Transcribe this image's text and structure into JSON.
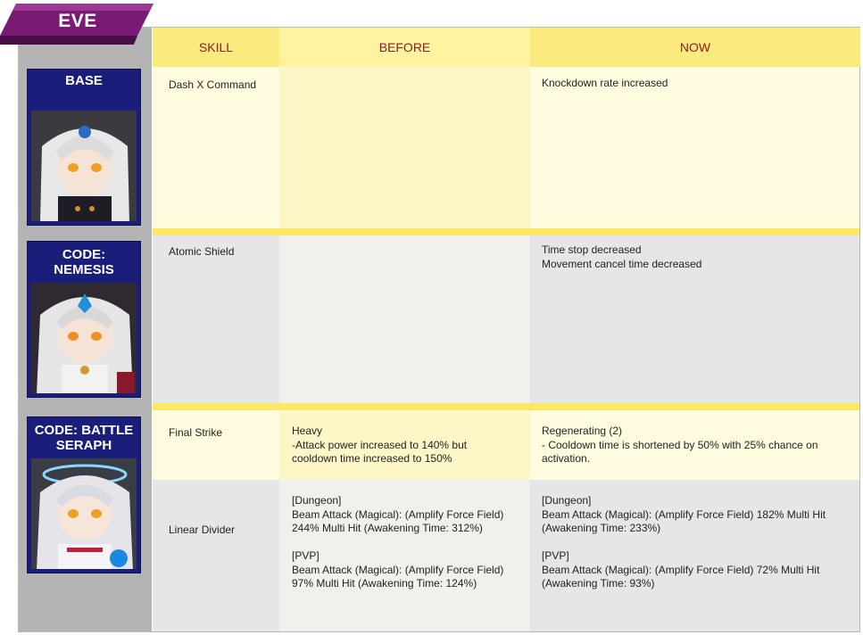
{
  "character": "EVE",
  "headers": {
    "skill": "SKILL",
    "before": "BEFORE",
    "now": "NOW"
  },
  "classes": [
    {
      "name": "BASE"
    },
    {
      "name": "CODE: NEMESIS"
    },
    {
      "name": "CODE: BATTLE SERAPH"
    }
  ],
  "rows": [
    {
      "skill": "Dash X Command",
      "before": [],
      "now": [
        "Knockdown rate increased"
      ]
    },
    {
      "skill": "Atomic Shield",
      "before": [],
      "now": [
        "Time stop decreased",
        "Movement cancel time decreased"
      ]
    },
    {
      "skill": "Final Strike",
      "before": [
        "Heavy",
        "-Attack power increased to 140% but",
        "cooldown time increased to 150%"
      ],
      "now": [
        "Regenerating (2)",
        "- Cooldown time is shortened by 50% with 25% chance on",
        "activation."
      ]
    },
    {
      "skill": "Linear Divider",
      "before": [
        "[Dungeon]",
        "Beam Attack (Magical): (Amplify Force Field)",
        "244% Multi Hit (Awakening Time: 312%)",
        "",
        "[PVP]",
        "Beam Attack (Magical): (Amplify Force Field)",
        "97% Multi Hit (Awakening Time: 124%)"
      ],
      "now": [
        "[Dungeon]",
        "Beam Attack (Magical): (Amplify Force Field) 182% Multi Hit",
        "(Awakening Time: 233%)",
        "",
        "[PVP]",
        "Beam Attack (Magical): (Amplify Force Field) 72% Multi Hit",
        "(Awakening Time: 93%)"
      ]
    }
  ],
  "colors": {
    "header_bg": "#fdf3a0",
    "header_text": "#8a2020",
    "separator": "#fde865",
    "tab": "#7a1a73",
    "portrait_bg": "#1a1e7a"
  }
}
